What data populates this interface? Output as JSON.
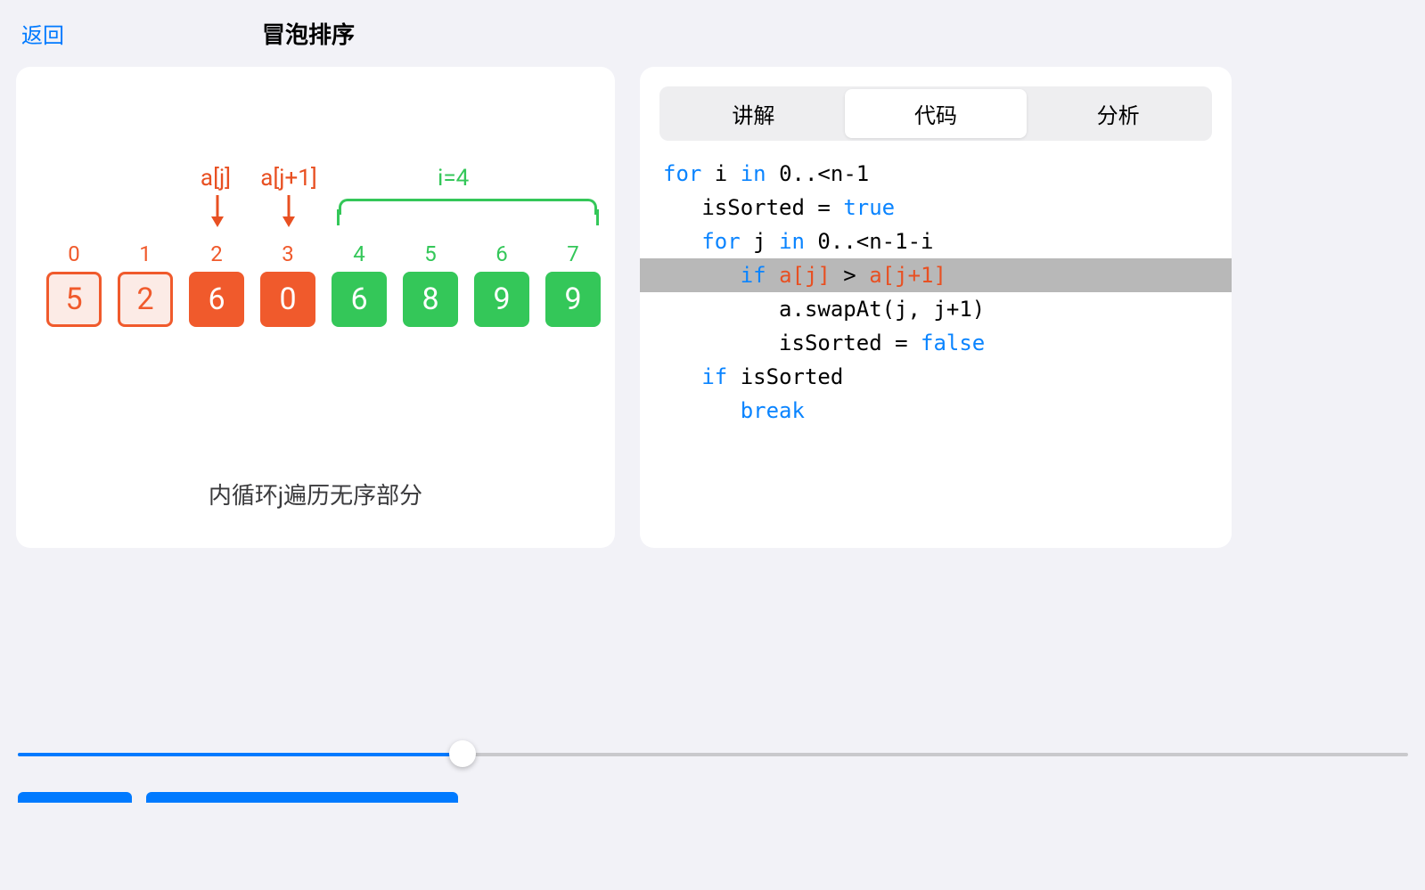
{
  "header": {
    "back": "返回",
    "title": "冒泡排序"
  },
  "viz": {
    "pointers": {
      "j_label": "a[j]",
      "j1_label": "a[j+1]"
    },
    "i_label": "i=4",
    "indices": [
      "0",
      "1",
      "2",
      "3",
      "4",
      "5",
      "6",
      "7"
    ],
    "cells": [
      {
        "v": "5",
        "state": "unsorted"
      },
      {
        "v": "2",
        "state": "unsorted"
      },
      {
        "v": "6",
        "state": "active"
      },
      {
        "v": "0",
        "state": "active"
      },
      {
        "v": "6",
        "state": "sorted"
      },
      {
        "v": "8",
        "state": "sorted"
      },
      {
        "v": "9",
        "state": "sorted"
      },
      {
        "v": "9",
        "state": "sorted"
      }
    ],
    "caption": "内循环j遍历无序部分"
  },
  "tabs": {
    "explain": "讲解",
    "code": "代码",
    "analyze": "分析",
    "active": "code"
  },
  "code": {
    "lines": [
      {
        "indent": 0,
        "hl": false,
        "tokens": [
          {
            "t": "for",
            "c": "kw"
          },
          {
            "t": " i "
          },
          {
            "t": "in",
            "c": "kw"
          },
          {
            "t": " 0..<n-1"
          }
        ]
      },
      {
        "indent": 1,
        "hl": false,
        "tokens": [
          {
            "t": "isSorted = "
          },
          {
            "t": "true",
            "c": "val"
          }
        ]
      },
      {
        "indent": 1,
        "hl": false,
        "tokens": [
          {
            "t": "for",
            "c": "kw"
          },
          {
            "t": " j "
          },
          {
            "t": "in",
            "c": "kw"
          },
          {
            "t": " 0..<n-1-i"
          }
        ]
      },
      {
        "indent": 2,
        "hl": true,
        "tokens": [
          {
            "t": "if",
            "c": "kw"
          },
          {
            "t": " "
          },
          {
            "t": "a[j]",
            "c": "orange"
          },
          {
            "t": " > "
          },
          {
            "t": "a[j+1]",
            "c": "orange"
          }
        ]
      },
      {
        "indent": 3,
        "hl": false,
        "tokens": [
          {
            "t": "a.swapAt(j, j+1)"
          }
        ]
      },
      {
        "indent": 3,
        "hl": false,
        "tokens": [
          {
            "t": "isSorted = "
          },
          {
            "t": "false",
            "c": "val"
          }
        ]
      },
      {
        "indent": 1,
        "hl": false,
        "tokens": [
          {
            "t": "if",
            "c": "kw"
          },
          {
            "t": " isSorted"
          }
        ]
      },
      {
        "indent": 2,
        "hl": false,
        "tokens": [
          {
            "t": "break",
            "c": "kw"
          }
        ]
      }
    ]
  },
  "slider": {
    "progress_pct": 32
  },
  "colors": {
    "accent": "#007aff",
    "orange": "#f05a2c",
    "green": "#34c759"
  }
}
